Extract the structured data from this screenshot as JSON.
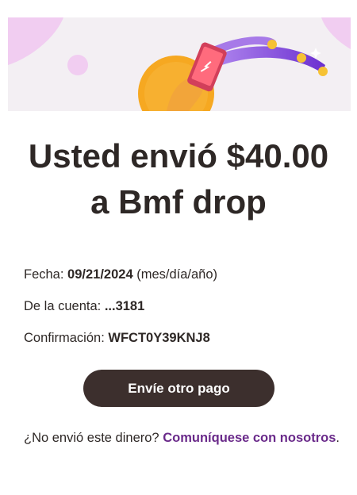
{
  "headline": {
    "line1": "Usted envió $40.00",
    "line2": "a Bmf drop"
  },
  "details": {
    "date": {
      "label": "Fecha:",
      "value": "09/21/2024",
      "suffix": "(mes/día/año)"
    },
    "account": {
      "label": "De la cuenta:",
      "value": "...3181"
    },
    "confirmation": {
      "label": "Confirmación:",
      "value": "WFCT0Y39KNJ8"
    }
  },
  "cta": {
    "label": "Envíe otro pago"
  },
  "footer": {
    "question": "¿No envió este dinero?",
    "link": "Comuníquese con nosotros",
    "period": "."
  },
  "illustration": {
    "icon": "phone-in-hand-sending-icon",
    "colors": {
      "coin": "#f6a821",
      "trail": "#7a3fd6",
      "phone": "#d23f5a",
      "dots": "#f6c234",
      "background": "#f3eff3",
      "decor": "#f1cdf1"
    }
  }
}
